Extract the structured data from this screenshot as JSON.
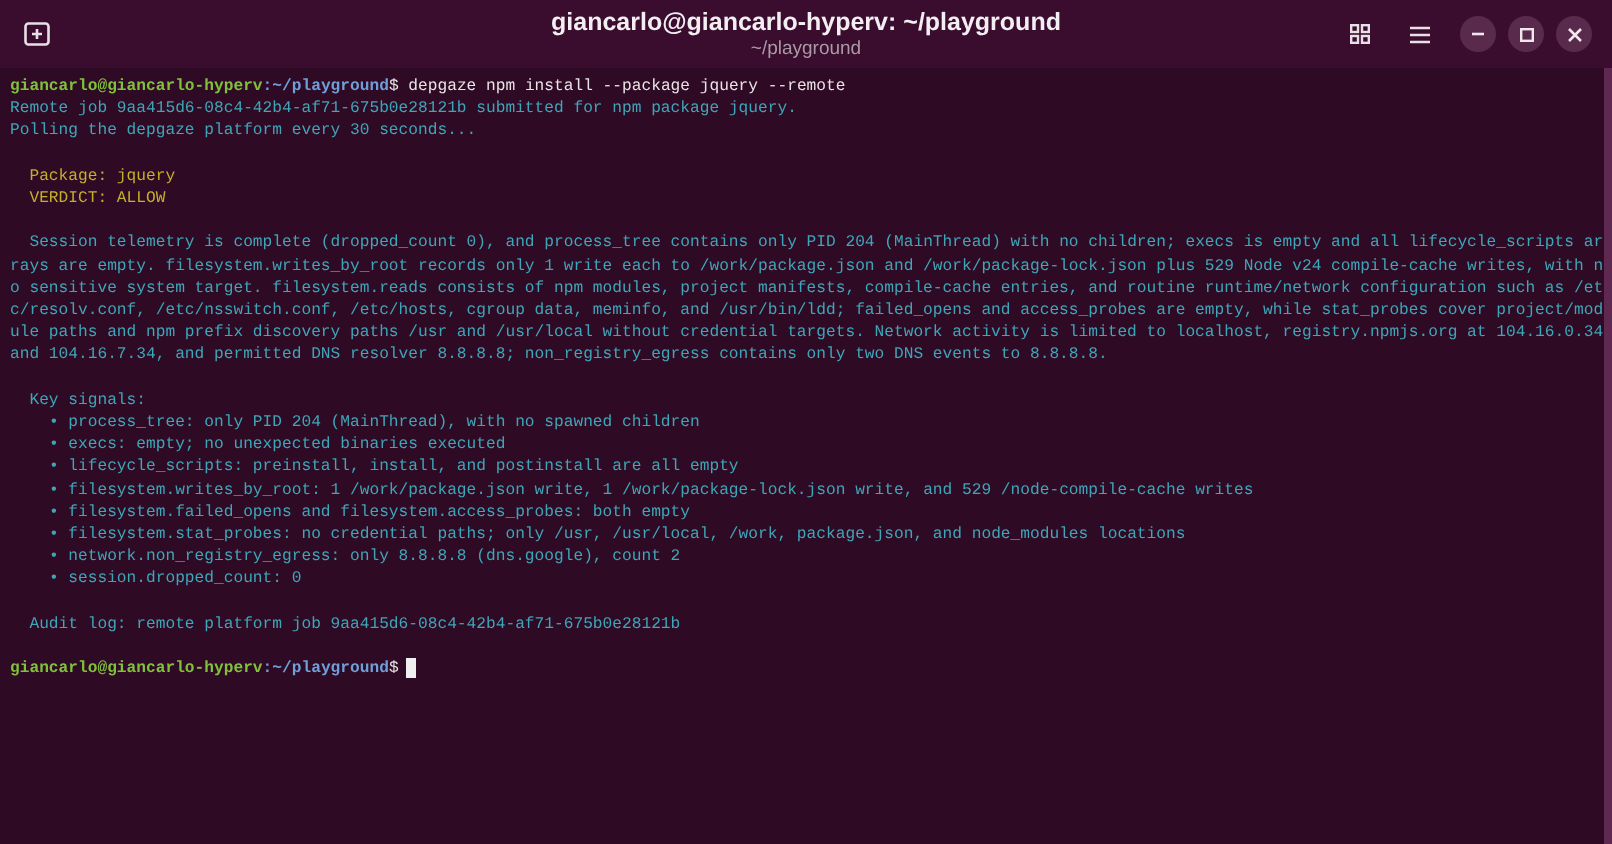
{
  "window": {
    "title": "giancarlo@giancarlo-hyperv: ~/playground",
    "subtitle": "~/playground"
  },
  "terminal": {
    "lines": [
      {
        "kind": "prompt",
        "user": "giancarlo@giancarlo-hyperv",
        "path": ":~/playground",
        "symbol": "$",
        "command": " depgaze npm install --package jquery --remote"
      },
      {
        "kind": "output",
        "text": "Remote job 9aa415d6-08c4-42b4-af71-675b0e28121b submitted for npm package jquery."
      },
      {
        "kind": "output",
        "text": "Polling the depgaze platform every 30 seconds..."
      },
      {
        "kind": "highlight",
        "blank_before": true,
        "text": "  Package: jquery"
      },
      {
        "kind": "highlight",
        "text": "  VERDICT: ALLOW"
      },
      {
        "kind": "output",
        "blank_before": true,
        "text": "  Session telemetry is complete (dropped_count 0), and process_tree contains only PID 204 (MainThread) with no children; execs is empty and all lifecycle_scripts arrays are empty. filesystem.writes_by_root records only 1 write each to /work/package.json and /work/package-lock.json plus 529 Node v24 compile-cache writes, with no sensitive system target. filesystem.reads consists of npm modules, project manifests, compile-cache entries, and routine runtime/network configuration such as /etc/resolv.conf, /etc/nsswitch.conf, /etc/hosts, cgroup data, meminfo, and /usr/bin/ldd; failed_opens and access_probes are empty, while stat_probes cover project/module paths and npm prefix discovery paths /usr and /usr/local without credential targets. Network activity is limited to localhost, registry.npmjs.org at 104.16.0.34 and 104.16.7.34, and permitted DNS resolver 8.8.8.8; non_registry_egress contains only two DNS events to 8.8.8.8."
      },
      {
        "kind": "output",
        "blank_before": true,
        "text": "  Key signals:"
      },
      {
        "kind": "output",
        "text": "    • process_tree: only PID 204 (MainThread), with no spawned children"
      },
      {
        "kind": "output",
        "text": "    • execs: empty; no unexpected binaries executed"
      },
      {
        "kind": "output",
        "text": "    • lifecycle_scripts: preinstall, install, and postinstall are all empty"
      },
      {
        "kind": "output",
        "text": "    • filesystem.writes_by_root: 1 /work/package.json write, 1 /work/package-lock.json write, and 529 /node-compile-cache writes"
      },
      {
        "kind": "output",
        "text": "    • filesystem.failed_opens and filesystem.access_probes: both empty"
      },
      {
        "kind": "output",
        "text": "    • filesystem.stat_probes: no credential paths; only /usr, /usr/local, /work, package.json, and node_modules locations"
      },
      {
        "kind": "output",
        "text": "    • network.non_registry_egress: only 8.8.8.8 (dns.google), count 2"
      },
      {
        "kind": "output",
        "text": "    • session.dropped_count: 0"
      },
      {
        "kind": "output",
        "blank_before": true,
        "text": "  Audit log: remote platform job 9aa415d6-08c4-42b4-af71-675b0e28121b"
      },
      {
        "kind": "prompt",
        "blank_before": true,
        "user": "giancarlo@giancarlo-hyperv",
        "path": ":~/playground",
        "symbol": "$",
        "cursor": true
      }
    ]
  }
}
